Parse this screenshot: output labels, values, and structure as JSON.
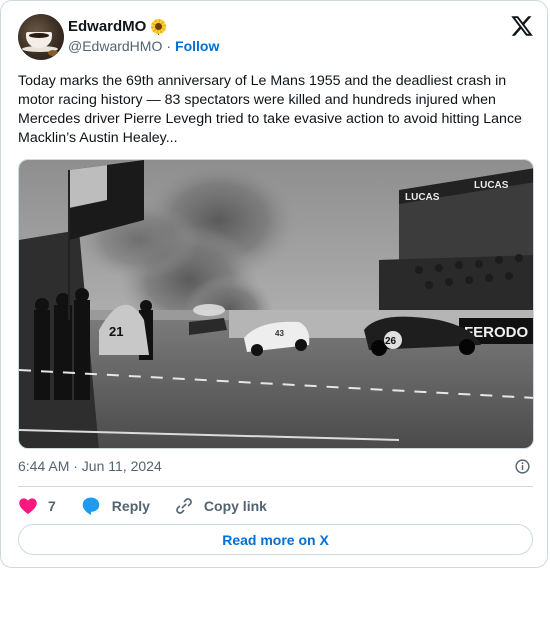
{
  "author": {
    "display_name": "EdwardMO",
    "handle": "@EdwardHMO",
    "separator": "·",
    "follow_label": "Follow",
    "name_emoji_icon": "sunflower-icon",
    "avatar_icon": "coffee-cup-avatar"
  },
  "platform": {
    "logo_icon": "x-logo-icon"
  },
  "tweet": {
    "text": "Today marks the 69th anniversary of Le Mans 1955 and the deadliest crash in motor racing history — 83 spectators were killed and hundreds injured when Mercedes driver Pierre Levegh tried to take evasive action to avoid hitting Lance Macklin’s Austin Healey...",
    "timestamp": "6:44 AM · Jun 11, 2024"
  },
  "photo": {
    "banner_left": "LUCAS",
    "banner_right": "LUCAS",
    "sign_text": "FERODO",
    "car_number_left": "21",
    "car_number_center": "43",
    "car_number_right": "26"
  },
  "actions": {
    "like_count": "7",
    "reply_label": "Reply",
    "copy_label": "Copy link"
  },
  "read_more_label": "Read more on X",
  "colors": {
    "link": "#006fd6",
    "like": "#f91880",
    "reply": "#1d9bf0",
    "muted": "#536471",
    "border": "#cfd9de"
  }
}
